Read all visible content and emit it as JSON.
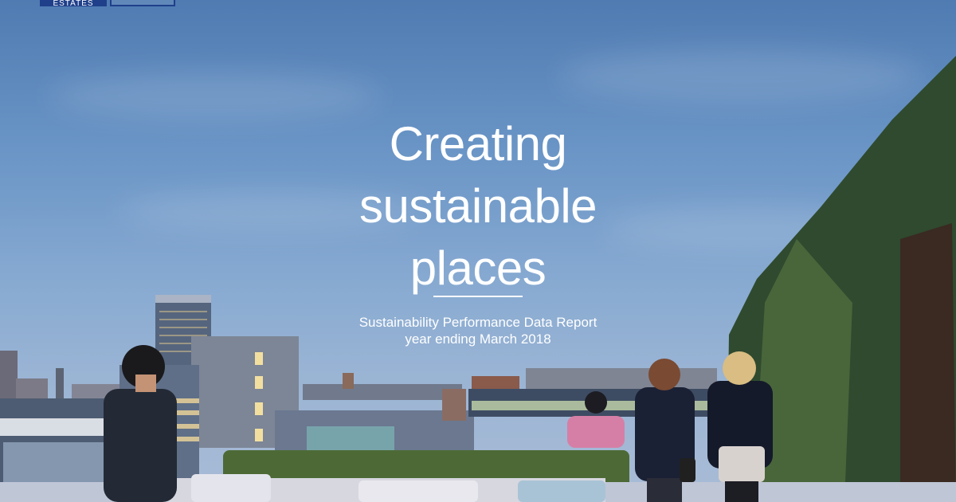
{
  "logo": {
    "text": "ESTATES"
  },
  "cover": {
    "title_line1": "Creating",
    "title_line2": "sustainable",
    "title_line3": "places",
    "subtitle_line1": "Sustainability Performance Data Report",
    "subtitle_line2": "year ending March 2018"
  },
  "colors": {
    "brand_blue": "#1f3f8a",
    "sky_top": "#4f7bb2",
    "sky_bottom": "#a9bcd6"
  }
}
